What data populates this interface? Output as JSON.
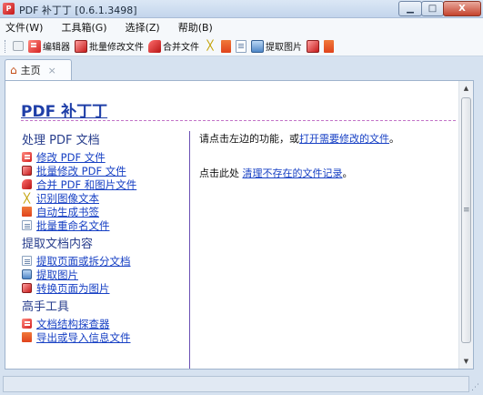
{
  "window": {
    "title": "PDF 补丁丁 [0.6.1.3498]",
    "icon": "pdf-patcher-app-icon",
    "minimize_glyph": "▁",
    "maximize_glyph": "□",
    "close_glyph": "X"
  },
  "menu": [
    {
      "label": "文件(W)"
    },
    {
      "label": "工具箱(G)"
    },
    {
      "label": "选择(Z)"
    },
    {
      "label": "帮助(B)"
    }
  ],
  "toolbar": {
    "editor_label": "编辑器",
    "batch_modify_label": "批量修改文件",
    "merge_label": "合并文件",
    "extract_images_label": "提取图片",
    "icons": [
      "checkbox-icon",
      "pdf-editor-icon",
      "batch-modify-icon",
      "merge-icon",
      "ocr-pen-icon",
      "bookmark-icon",
      "page-extract-icon",
      "extract-image-icon",
      "render-page-icon",
      "export-info-icon"
    ]
  },
  "tabs": [
    {
      "label": "主页",
      "close": "×",
      "icon": "home-icon"
    }
  ],
  "page": {
    "title": "PDF 补丁丁",
    "sections": [
      {
        "title": "处理 PDF 文档",
        "links": [
          {
            "label": "修改 PDF 文件",
            "icon": "pdf-edit-icon"
          },
          {
            "label": "批量修改 PDF 文件",
            "icon": "batch-modify-icon"
          },
          {
            "label": "合并 PDF 和图片文件",
            "icon": "merge-icon"
          },
          {
            "label": "识别图像文本",
            "icon": "ocr-pen-icon"
          },
          {
            "label": "自动生成书签",
            "icon": "bookmark-icon"
          },
          {
            "label": "批量重命名文件",
            "icon": "rename-icon"
          }
        ]
      },
      {
        "title": "提取文档内容",
        "links": [
          {
            "label": "提取页面或拆分文档",
            "icon": "page-extract-icon"
          },
          {
            "label": "提取图片",
            "icon": "extract-image-icon"
          },
          {
            "label": "转换页面为图片",
            "icon": "render-page-icon"
          }
        ]
      },
      {
        "title": "高手工具",
        "links": [
          {
            "label": "文档结构探查器",
            "icon": "structure-explorer-icon"
          },
          {
            "label": "导出或导入信息文件",
            "icon": "export-info-icon"
          }
        ]
      }
    ],
    "main": {
      "line1_prefix": "请点击左边的功能，或",
      "line1_link": "打开需要修改的文件",
      "line1_suffix": "。",
      "line2_prefix": "点击此处 ",
      "line2_link": "清理不存在的文件记录",
      "line2_suffix": "。"
    }
  },
  "statusbar": {
    "text": ""
  },
  "colors": {
    "link": "#1740c4",
    "section_title": "#273d8c",
    "page_title": "#1f3fa8",
    "accent_rule": "#c273c7"
  }
}
